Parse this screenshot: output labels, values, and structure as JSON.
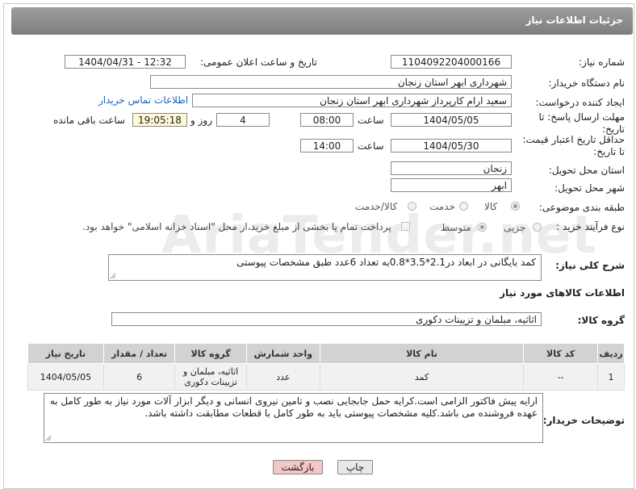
{
  "header": {
    "title": "جزئیات اطلاعات نیاز"
  },
  "form": {
    "need_number_label": "شماره نیاز:",
    "need_number": "1104092204000166",
    "announce_label": "تاریخ و ساعت اعلان عمومی:",
    "announce_value": "1404/04/31 - 12:32",
    "buyer_org_label": "نام دستگاه خریدار:",
    "buyer_org": "شهرداری ابهر استان زنجان",
    "requester_label": "ایجاد کننده درخواست:",
    "requester": "سعید ارام کارپرداز  شهرداری ابهر استان زنجان",
    "contact_link": "اطلاعات تماس خریدار",
    "deadline_label_1": "مهلت ارسال پاسخ: تا",
    "deadline_label_2": "تاریخ:",
    "deadline_date": "1404/05/05",
    "time_word": "ساعت",
    "deadline_time": "08:00",
    "days_value": "4",
    "days_word": "روز و",
    "remaining_time": "19:05:18",
    "remaining_word": "ساعت باقی مانده",
    "price_label_1": "حداقل تاریخ اعتبار قیمت:",
    "price_label_2": "تا تاریخ:",
    "price_date": "1404/05/30",
    "price_time": "14:00",
    "province_label": "استان محل تحویل:",
    "province": "زنجان",
    "city_label": "شهر محل تحویل:",
    "city": "ابهر",
    "category_label": "طبقه بندی موضوعی:",
    "category_options": [
      "کالا",
      "خدمت",
      "کالا/خدمت"
    ],
    "process_label": "نوع فرآیند خرید :",
    "process_options": [
      "جزیی",
      "متوسط"
    ],
    "payment_note": "پرداخت تمام یا بخشی از مبلغ خرید،از محل \"اسناد خزانه اسلامی\" خواهد بود.",
    "summary_label": "شرح کلی نیاز:",
    "summary": "کمد بایگانی در ابعاد در2.1*3.5*0.8به تعداد 6عدد طبق مشخصات پیوستی",
    "goods_info_title": "اطلاعات کالاهای مورد نیاز",
    "goods_group_label": "گروه کالا:",
    "goods_group": "اثاثیه، مبلمان و تزیینات دکوری",
    "buyer_notes_label": "توضیحات خریدار:",
    "buyer_notes": "ارایه پیش فاکتور الزامی است.کرایه حمل  جابجایی  نصب و تامین نیروی انسانی و دیگر ابزار آلات مورد نیاز به طور کامل به عهده فروشنده می باشد.کلیه مشخصات پیوستی باید به طور کامل با قطعات مطابقت داشته باشد."
  },
  "table": {
    "headers": [
      "ردیف",
      "کد کالا",
      "نام کالا",
      "واحد شمارش",
      "گروه کالا",
      "تعداد / مقدار",
      "تاریخ نیاز"
    ],
    "rows": [
      {
        "row": "1",
        "code": "--",
        "name": "کمد",
        "unit": "عدد",
        "group": "اثاثیه، مبلمان و تزیینات دکوری",
        "qty": "6",
        "date": "1404/05/05"
      }
    ]
  },
  "buttons": {
    "print": "چاپ",
    "back": "بازگشت"
  },
  "watermark": "AriaTender.net",
  "colors": {
    "header_bg": "#8a8a8a",
    "link": "#1b64c0",
    "back_button": "#f4c6c6",
    "print_button": "#e8e8e8"
  }
}
